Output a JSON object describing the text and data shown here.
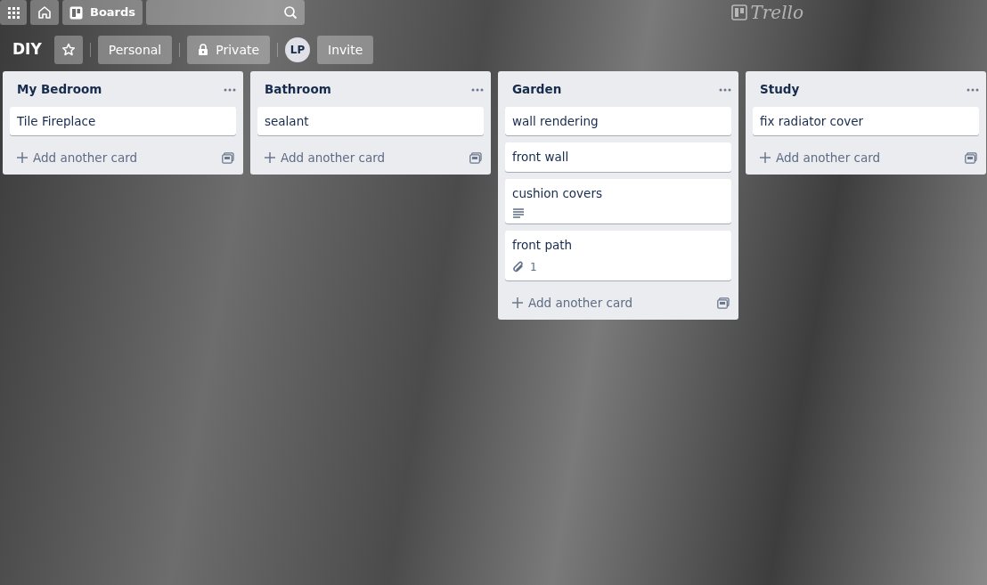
{
  "header": {
    "boards_label": "Boards",
    "logo_text": "Trello"
  },
  "board_bar": {
    "title": "DIY",
    "starred": false,
    "team": "Personal",
    "visibility": "Private",
    "member_initials": "LP",
    "invite": "Invite"
  },
  "lists": [
    {
      "title": "My Bedroom",
      "cards": [
        {
          "title": "Tile Fireplace"
        }
      ],
      "add_label": "Add another card"
    },
    {
      "title": "Bathroom",
      "cards": [
        {
          "title": "sealant"
        }
      ],
      "add_label": "Add another card"
    },
    {
      "title": "Garden",
      "cards": [
        {
          "title": "wall rendering"
        },
        {
          "title": "front wall"
        },
        {
          "title": "cushion covers",
          "badges": [
            {
              "kind": "description"
            }
          ]
        },
        {
          "title": "front path",
          "badges": [
            {
              "kind": "attachment",
              "count": "1"
            }
          ]
        }
      ],
      "add_label": "Add another card"
    },
    {
      "title": "Study",
      "cards": [
        {
          "title": "fix radiator cover"
        }
      ],
      "add_label": "Add another card"
    }
  ]
}
